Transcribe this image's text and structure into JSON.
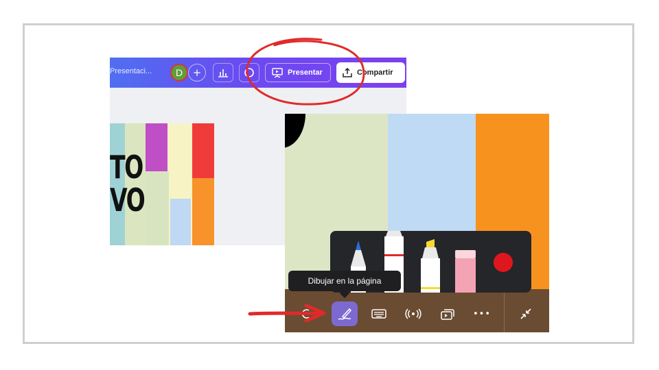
{
  "editor": {
    "doc_title": "Presentaci...",
    "avatar_initial": "D",
    "add_label": "+",
    "present_label": "Presentar",
    "share_label": "Compartir"
  },
  "slide": {
    "text_line1": "TO",
    "text_line2": "VO"
  },
  "presentation": {
    "tooltip": "Dibujar en la página",
    "more_label": "•••"
  },
  "colors": {
    "accent": "#7d3fef",
    "annotation": "#e02a2a",
    "toolbar": "#6a4c32",
    "active_tool": "#7d6ad1"
  },
  "icons": {
    "analytics": "bar-chart-icon",
    "comment": "comment-icon",
    "present": "presentation-screen-icon",
    "share": "share-icon",
    "draw": "pen-draw-icon",
    "keyboard": "keyboard-icon",
    "live": "broadcast-icon",
    "screens": "screens-icon",
    "exit_fullscreen": "minimize-icon",
    "pen": "pen-tool-icon",
    "marker": "marker-tool-icon",
    "highlighter": "highlighter-tool-icon",
    "eraser": "eraser-tool-icon",
    "color": "color-swatch-icon"
  }
}
